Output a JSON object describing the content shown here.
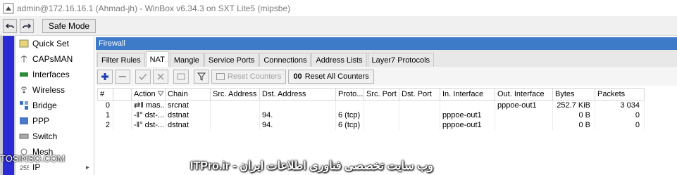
{
  "window": {
    "title": "admin@172.16.16.1 (Ahmad-jh) - WinBox v6.34.3 on SXT Lite5 (mipsbe)"
  },
  "toolbar": {
    "undo_icon": "undo-icon",
    "redo_icon": "redo-icon",
    "safe_mode_label": "Safe Mode"
  },
  "sidebar": {
    "items": [
      {
        "label": "Quick Set",
        "icon": "quick-set-icon"
      },
      {
        "label": "CAPsMAN",
        "icon": "capsman-icon"
      },
      {
        "label": "Interfaces",
        "icon": "interfaces-icon"
      },
      {
        "label": "Wireless",
        "icon": "wireless-icon"
      },
      {
        "label": "Bridge",
        "icon": "bridge-icon"
      },
      {
        "label": "PPP",
        "icon": "ppp-icon"
      },
      {
        "label": "Switch",
        "icon": "switch-icon"
      },
      {
        "label": "Mesh",
        "icon": "mesh-icon"
      },
      {
        "label": "IP",
        "icon": "ip-icon",
        "caret": "▸"
      }
    ]
  },
  "firewall": {
    "title": "Firewall",
    "tabs": [
      "Filter Rules",
      "NAT",
      "Mangle",
      "Service Ports",
      "Connections",
      "Address Lists",
      "Layer7 Protocols"
    ],
    "active_tab": "NAT",
    "actions": {
      "reset_counters": "Reset Counters",
      "reset_all_counters": "Reset All Counters",
      "oo_label": "00"
    },
    "columns": [
      "#",
      "",
      "Action",
      "Chain",
      "Src. Address",
      "Dst. Address",
      "Proto...",
      "Src. Port",
      "Dst. Port",
      "In. Interface",
      "Out. Interface",
      "Bytes",
      "Packets"
    ],
    "rows": [
      {
        "num": "0",
        "action": "mas...",
        "chain": "srcnat",
        "src": "",
        "dst": "",
        "proto": "",
        "sport": "",
        "dport": "",
        "in": "",
        "out": "pppoe-out1",
        "bytes": "252.7 KiB",
        "packets": "3 034"
      },
      {
        "num": "1",
        "action": "dst-...",
        "chain": "dstnat",
        "src": "",
        "dst": "94.",
        "proto": "6 (tcp)",
        "sport": "",
        "dport": "",
        "in": "pppoe-out1",
        "out": "",
        "bytes": "0 B",
        "packets": "0"
      },
      {
        "num": "2",
        "action": "dst-...",
        "chain": "dstnat",
        "src": "",
        "dst": "94.",
        "proto": "6 (tcp)",
        "sport": "",
        "dport": "",
        "in": "pppoe-out1",
        "out": "",
        "bytes": "0 B",
        "packets": "0"
      }
    ]
  },
  "watermarks": {
    "left": "TOSINSO.COM",
    "bottom": "ITPro.ir - وب سایت تخصصی فناوری اطلاعات ایران"
  }
}
